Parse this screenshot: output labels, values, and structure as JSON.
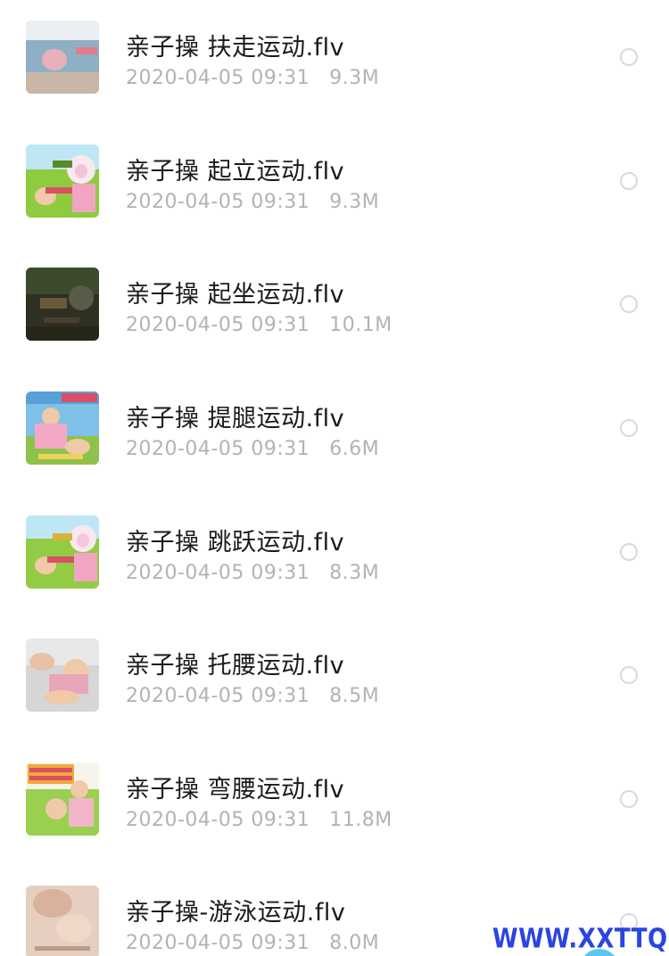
{
  "files": [
    {
      "name": "亲子操 扶走运动.flv",
      "date": "2020-04-05 09:31",
      "size": "9.3M",
      "thumb": {
        "bg": "#a9c3cf",
        "accent": "#e8b0b8"
      }
    },
    {
      "name": "亲子操 起立运动.flv",
      "date": "2020-04-05 09:31",
      "size": "9.3M",
      "thumb": {
        "bg": "#8fcb3f",
        "accent": "#f2c4d6"
      }
    },
    {
      "name": "亲子操 起坐运动.flv",
      "date": "2020-04-05 09:31",
      "size": "10.1M",
      "thumb": {
        "bg": "#3a3a28",
        "accent": "#6b5a3a"
      }
    },
    {
      "name": "亲子操 提腿运动.flv",
      "date": "2020-04-05 09:31",
      "size": "6.6M",
      "thumb": {
        "bg": "#7fc0e8",
        "accent": "#f3a9c6"
      }
    },
    {
      "name": "亲子操 跳跃运动.flv",
      "date": "2020-04-05 09:31",
      "size": "8.3M",
      "thumb": {
        "bg": "#92cc45",
        "accent": "#f4c8da"
      }
    },
    {
      "name": "亲子操 托腰运动.flv",
      "date": "2020-04-05 09:31",
      "size": "8.5M",
      "thumb": {
        "bg": "#cfcfcf",
        "accent": "#e9a6b8"
      }
    },
    {
      "name": "亲子操 弯腰运动.flv",
      "date": "2020-04-05 09:31",
      "size": "11.8M",
      "thumb": {
        "bg": "#9ad04f",
        "accent": "#f2b5c8"
      }
    },
    {
      "name": "亲子操-游泳运动.flv",
      "date": "2020-04-05 09:31",
      "size": "8.0M",
      "thumb": {
        "bg": "#e6cfc0",
        "accent": "#d9b29e"
      }
    }
  ],
  "watermark": "WWW.XXTTQ.COM",
  "colors": {
    "title_text": "#1a1a1a",
    "meta_text": "#b3b3b3",
    "radio_border": "#d9d9d9",
    "watermark": "#2a45e0",
    "fab": "#5cc6f2"
  },
  "icons": {
    "row_select": "radio-unchecked-icon"
  }
}
